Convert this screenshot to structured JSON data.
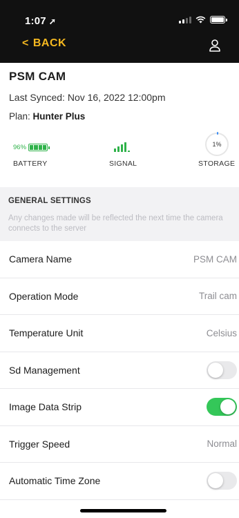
{
  "status_bar": {
    "time": "1:07",
    "location_glyph": "➚"
  },
  "nav": {
    "back_label": "BACK"
  },
  "camera": {
    "name": "PSM CAM",
    "last_synced": "Last Synced:  Nov 16, 2022 12:00pm",
    "plan_prefix": "Plan: ",
    "plan_name": "Hunter Plus"
  },
  "stats": {
    "battery_percent": "96%",
    "battery_label": "BATTERY",
    "signal_label": "SIGNAL",
    "storage_percent": "1%",
    "storage_label": "STORAGE"
  },
  "general_settings": {
    "title": "GENERAL SETTINGS",
    "note": "Any changes made will be reflected the next time the camera connects to the server"
  },
  "settings": {
    "camera_name": {
      "label": "Camera Name",
      "value": "PSM  CAM"
    },
    "operation_mode": {
      "label": "Operation Mode",
      "value": "Trail cam"
    },
    "temperature_unit": {
      "label": "Temperature Unit",
      "value": "Celsius"
    },
    "sd_management": {
      "label": "Sd Management",
      "enabled": false
    },
    "image_data_strip": {
      "label": "Image Data Strip",
      "enabled": true
    },
    "trigger_speed": {
      "label": "Trigger Speed",
      "value": "Normal"
    },
    "automatic_time_zone": {
      "label": "Automatic Time Zone",
      "enabled": false
    }
  },
  "colors": {
    "accent": "#f5b820",
    "good": "#2fb24a",
    "toggle_on": "#34c759",
    "toggle_off": "#e9e9eb"
  },
  "icons": {
    "back": "chevron-left-icon",
    "account": "user-icon",
    "battery": "battery-icon",
    "signal": "signal-bars-icon",
    "storage": "storage-ring-icon"
  }
}
